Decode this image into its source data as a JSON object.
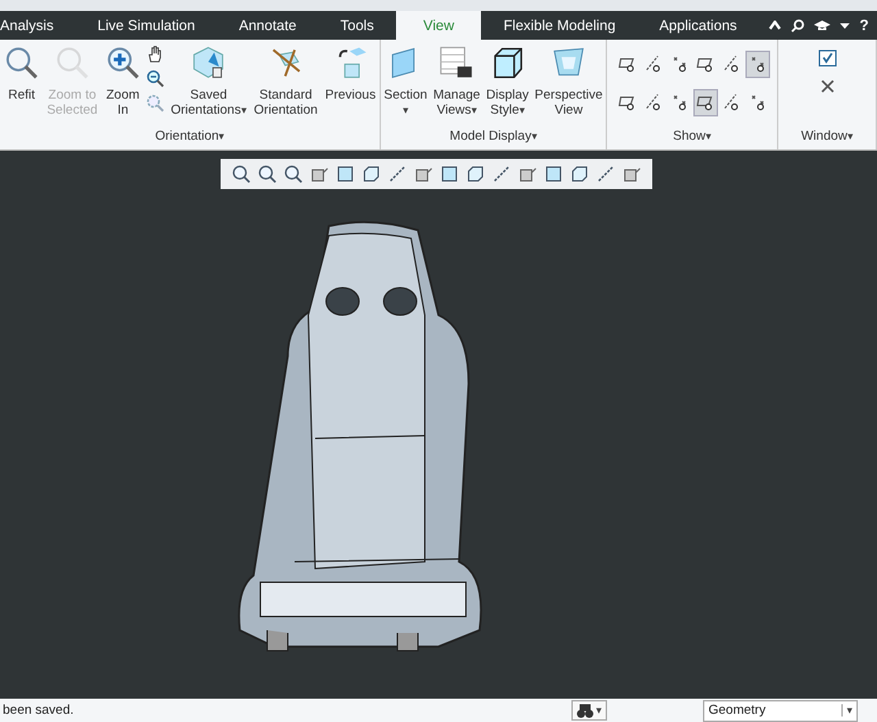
{
  "tabs": [
    {
      "label": "Analysis",
      "selected": false
    },
    {
      "label": "Live Simulation",
      "selected": false
    },
    {
      "label": "Annotate",
      "selected": false
    },
    {
      "label": "Tools",
      "selected": false
    },
    {
      "label": "View",
      "selected": true
    },
    {
      "label": "Flexible Modeling",
      "selected": false
    },
    {
      "label": "Applications",
      "selected": false
    }
  ],
  "help_label": "?",
  "groups": [
    {
      "label": "Orientation",
      "caret": "▾",
      "buttons": [
        {
          "lines": [
            "Refit"
          ],
          "disabled": false
        },
        {
          "lines": [
            "Zoom to",
            "Selected"
          ],
          "disabled": true
        },
        {
          "lines": [
            "Zoom",
            "In"
          ],
          "disabled": false
        },
        {
          "lines": [
            "Saved",
            "Orientations"
          ],
          "caret": "▾",
          "disabled": false
        },
        {
          "lines": [
            "Standard",
            "Orientation"
          ],
          "disabled": false
        },
        {
          "lines": [
            "Previous"
          ],
          "disabled": false
        }
      ]
    },
    {
      "label": "Model Display",
      "caret": "▾",
      "buttons": [
        {
          "lines": [
            "Section"
          ],
          "caret": "▾",
          "disabled": false
        },
        {
          "lines": [
            "Manage",
            "Views"
          ],
          "caret": "▾",
          "disabled": false
        },
        {
          "lines": [
            "Display",
            "Style"
          ],
          "caret": "▾",
          "disabled": false
        },
        {
          "lines": [
            "Perspective",
            "View"
          ],
          "disabled": false
        }
      ]
    },
    {
      "label": "Show",
      "caret": "▾"
    },
    {
      "label": "Window",
      "caret": "▾"
    }
  ],
  "show_toggles": [
    {
      "selected": false
    },
    {
      "selected": false
    },
    {
      "selected": false
    },
    {
      "selected": false
    },
    {
      "selected": false
    },
    {
      "selected": true
    },
    {
      "selected": false
    },
    {
      "selected": false
    },
    {
      "selected": false
    },
    {
      "selected": true
    },
    {
      "selected": false
    },
    {
      "selected": false
    }
  ],
  "status": {
    "message": "been saved.",
    "find_caret": "▾",
    "filter": "Geometry",
    "filter_caret": "▾"
  }
}
